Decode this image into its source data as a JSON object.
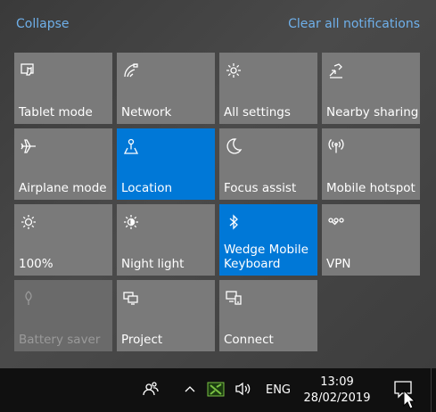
{
  "header": {
    "collapse_label": "Collapse",
    "clear_label": "Clear all notifications"
  },
  "colors": {
    "accent": "#0078d7",
    "tile": "#7a7a7a",
    "link": "#6fb0ea"
  },
  "tiles": [
    {
      "label": "Tablet mode",
      "icon": "tablet-mode-icon",
      "state": "off"
    },
    {
      "label": "Network",
      "icon": "network-icon",
      "state": "off"
    },
    {
      "label": "All settings",
      "icon": "gear-icon",
      "state": "off"
    },
    {
      "label": "Nearby sharing",
      "icon": "nearby-sharing-icon",
      "state": "off"
    },
    {
      "label": "Airplane mode",
      "icon": "airplane-icon",
      "state": "off"
    },
    {
      "label": "Location",
      "icon": "location-icon",
      "state": "on"
    },
    {
      "label": "Focus assist",
      "icon": "moon-icon",
      "state": "off"
    },
    {
      "label": "Mobile hotspot",
      "icon": "hotspot-icon",
      "state": "off"
    },
    {
      "label": "100%",
      "icon": "brightness-icon",
      "state": "off"
    },
    {
      "label": "Night light",
      "icon": "night-light-icon",
      "state": "off"
    },
    {
      "label": "Wedge Mobile Keyboard",
      "icon": "bluetooth-icon",
      "state": "on"
    },
    {
      "label": "VPN",
      "icon": "vpn-icon",
      "state": "off"
    },
    {
      "label": "Battery saver",
      "icon": "battery-saver-icon",
      "state": "disabled"
    },
    {
      "label": "Project",
      "icon": "project-icon",
      "state": "off"
    },
    {
      "label": "Connect",
      "icon": "connect-icon",
      "state": "off"
    }
  ],
  "taskbar": {
    "language": "ENG",
    "time": "13:09",
    "date": "28/02/2019"
  }
}
